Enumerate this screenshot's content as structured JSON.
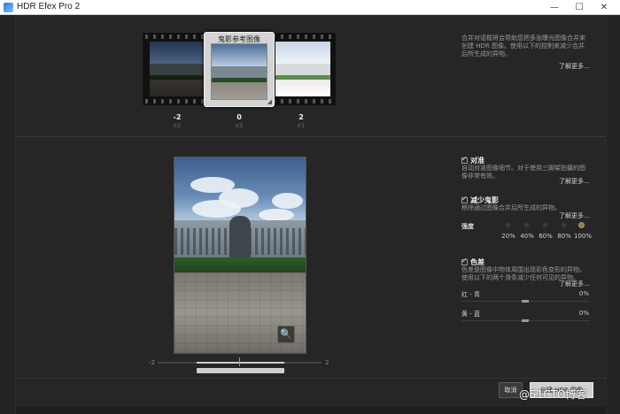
{
  "window": {
    "title": "HDR Efex Pro 2",
    "minimize": "—",
    "maximize": "☐",
    "close": "✕"
  },
  "filmstrip": {
    "selected_label": "鬼影参考图像",
    "thumbs": [
      {
        "ev": "-2",
        "tag": "e2"
      },
      {
        "ev": "0",
        "tag": "e3"
      },
      {
        "ev": "2",
        "tag": "e1"
      }
    ]
  },
  "merge_info": {
    "text": "合并对话框将会帮助您把多张曝光图像合并来创建 HDR 图像。使用以下的控制来减少合并后所生成的异物。",
    "learn_more": "了解更多..."
  },
  "panel": {
    "align": {
      "title": "对准",
      "desc": "自动对准图像细节。对于使用三脚架拍摄的图像非常有效。",
      "learn_more": "了解更多..."
    },
    "ghost": {
      "title": "减少鬼影",
      "desc": "移除通过图像合并后所生成的异物。",
      "learn_more": "了解更多...",
      "strength_label": "强度",
      "options": [
        "20%",
        "40%",
        "60%",
        "80%",
        "100%"
      ],
      "selected": "100%"
    },
    "chromatic": {
      "title": "色差",
      "desc": "色差是图像中物体周围出现彩色变形的异物。使用以下的两个滑条减少任何可见的异物。",
      "learn_more": "了解更多...",
      "rows": [
        {
          "label": "红 - 青",
          "value": "0%"
        },
        {
          "label": "黄 - 蓝",
          "value": "0%"
        }
      ]
    }
  },
  "exposure_slider": {
    "min_label": "-2",
    "max_label": "2"
  },
  "buttons": {
    "cancel": "取消",
    "ok": "创建 HDR 图像"
  },
  "watermark": "@51CTO博客",
  "icons": {
    "loupe": "magnifier-icon"
  }
}
